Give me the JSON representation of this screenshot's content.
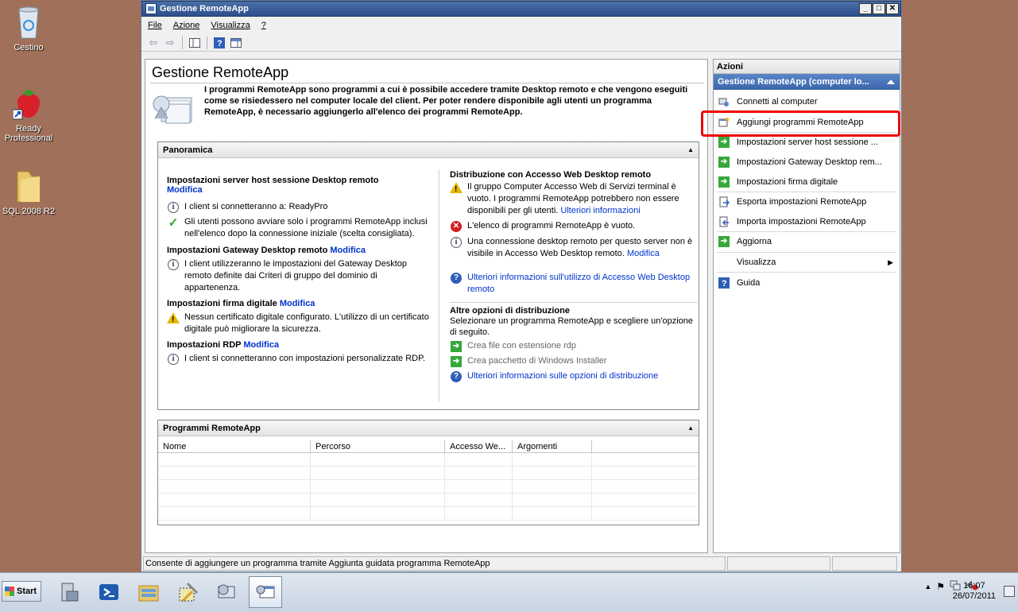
{
  "desktop": {
    "icons": [
      {
        "label": "Cestino"
      },
      {
        "label": "Ready Professional"
      },
      {
        "label": "SQL 2008 R2"
      }
    ]
  },
  "window": {
    "title": "Gestione RemoteApp",
    "menu": [
      "File",
      "Azione",
      "Visualizza",
      "?"
    ],
    "page_title": "Gestione RemoteApp",
    "intro": "I programmi RemoteApp sono programmi a cui è possibile accedere tramite Desktop remoto e che vengono eseguiti come se risiedessero nel computer locale del client. Per poter rendere disponibile agli utenti un programma RemoteApp, è necessario aggiungerlo all'elenco dei programmi RemoteApp.",
    "overview": {
      "title": "Panoramica",
      "left": {
        "rdsh_head": "Impostazioni server host sessione Desktop remoto",
        "rdsh_link": "Modifica",
        "rdsh_item1": "I client si connetteranno a: ReadyPro",
        "rdsh_item2": "Gli utenti possono avviare solo i programmi RemoteApp inclusi nell'elenco dopo la connessione iniziale (scelta consigliata).",
        "gw_head": "Impostazioni Gateway Desktop remoto",
        "gw_link": "Modifica",
        "gw_item": "I client utilizzeranno le impostazioni del Gateway Desktop remoto definite dai Criteri di gruppo del dominio di appartenenza.",
        "sig_head": "Impostazioni firma digitale",
        "sig_link": "Modifica",
        "sig_item": "Nessun certificato digitale configurato. L'utilizzo di un certificato digitale può migliorare la sicurezza.",
        "rdp_head": "Impostazioni RDP",
        "rdp_link": "Modifica",
        "rdp_item": "I client si connetteranno con impostazioni personalizzate RDP."
      },
      "right": {
        "web_head": "Distribuzione con Accesso Web Desktop remoto",
        "web_item1": "Il gruppo Computer Accesso Web di Servizi terminal è vuoto. I programmi RemoteApp potrebbero non essere disponibili per gli utenti.",
        "web_item1_link": "Ulteriori informazioni",
        "web_item2": "L'elenco di programmi RemoteApp è vuoto.",
        "web_item3": "Una connessione desktop remoto per questo server non è visibile in Accesso Web Desktop remoto.",
        "web_item3_link": "Modifica",
        "web_more": "Ulteriori informazioni sull'utilizzo di Accesso Web Desktop remoto",
        "other_head": "Altre opzioni di distribuzione",
        "other_desc": "Selezionare un programma RemoteApp e scegliere un'opzione di seguito.",
        "other_item1": "Crea file con estensione rdp",
        "other_item2": "Crea pacchetto di Windows Installer",
        "other_more": "Ulteriori informazioni sulle opzioni di distribuzione"
      }
    },
    "programs": {
      "title": "Programmi RemoteApp",
      "columns": [
        "Nome",
        "Percorso",
        "Accesso We...",
        "Argomenti"
      ]
    },
    "actions": {
      "title": "Azioni",
      "subtitle": "Gestione RemoteApp (computer lo...",
      "items": [
        {
          "label": "Connetti al computer",
          "icon": "connect-icon"
        },
        {
          "label": "Aggiungi programmi RemoteApp",
          "icon": "add-program-icon"
        },
        {
          "label": "Impostazioni server host sessione ...",
          "icon": "green-arrow-icon"
        },
        {
          "label": "Impostazioni Gateway Desktop rem...",
          "icon": "green-arrow-icon"
        },
        {
          "label": "Impostazioni firma digitale",
          "icon": "green-arrow-icon"
        },
        {
          "label": "Esporta impostazioni RemoteApp",
          "icon": "export-icon"
        },
        {
          "label": "Importa impostazioni RemoteApp",
          "icon": "import-icon"
        },
        {
          "label": "Aggiorna",
          "icon": "refresh-icon"
        },
        {
          "label": "Visualizza",
          "icon": "none"
        },
        {
          "label": "Guida",
          "icon": "help-icon"
        }
      ]
    },
    "status": "Consente di aggiungere un programma tramite Aggiunta guidata programma RemoteApp"
  },
  "taskbar": {
    "start_label": "Start",
    "time": "16:07",
    "date": "26/07/2011"
  }
}
